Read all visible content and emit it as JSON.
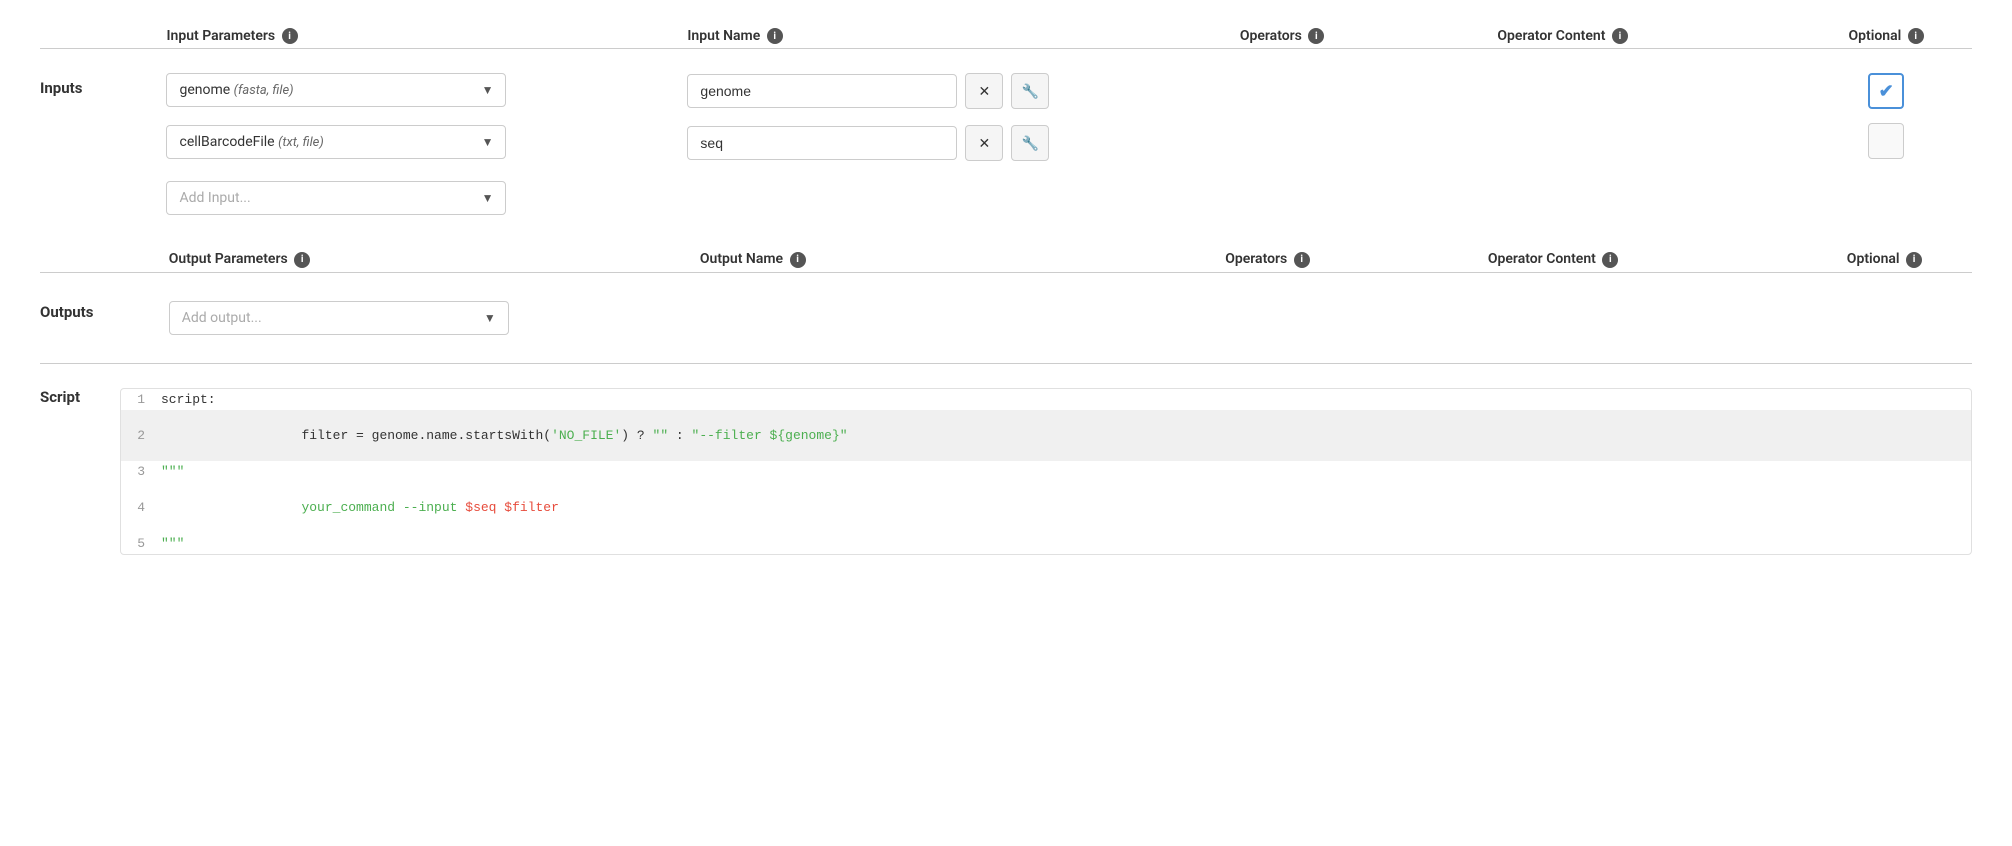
{
  "inputs_section": {
    "label": "Inputs",
    "columns": {
      "input_parameters": "Input Parameters",
      "input_name": "Input Name",
      "operators": "Operators",
      "operator_content": "Operator Content",
      "optional": "Optional"
    },
    "rows": [
      {
        "parameter_label": "genome",
        "parameter_detail": "(fasta, file)",
        "name_value": "genome",
        "optional_checked": true
      },
      {
        "parameter_label": "cellBarcodeFile",
        "parameter_detail": "(txt, file)",
        "name_value": "seq",
        "optional_checked": false
      }
    ],
    "add_input_placeholder": "Add Input..."
  },
  "outputs_section": {
    "label": "Outputs",
    "columns": {
      "output_parameters": "Output Parameters",
      "output_name": "Output Name",
      "operators": "Operators",
      "operator_content": "Operator Content",
      "optional": "Optional"
    },
    "add_output_placeholder": "Add output..."
  },
  "script_section": {
    "label": "Script",
    "lines": [
      {
        "num": "1",
        "content": "script:",
        "highlighted": false,
        "parts": [
          {
            "text": "script:",
            "class": "c-default"
          }
        ]
      },
      {
        "num": "2",
        "content": "filter = genome.name.startsWith('NO_FILE') ? \"\" : \"--filter ${genome}\"",
        "highlighted": true,
        "parts": [
          {
            "text": "filter = genome.name.startsWith(",
            "class": "c-default"
          },
          {
            "text": "'NO_FILE'",
            "class": "c-string"
          },
          {
            "text": ") ? ",
            "class": "c-default"
          },
          {
            "text": "\"\"",
            "class": "c-string"
          },
          {
            "text": " : ",
            "class": "c-default"
          },
          {
            "text": "\"--filter ${genome}\"",
            "class": "c-string"
          }
        ]
      },
      {
        "num": "3",
        "content": "\"\"\"",
        "highlighted": false,
        "parts": [
          {
            "text": "\"\"\"",
            "class": "c-green"
          }
        ]
      },
      {
        "num": "4",
        "content": "your_command --input $seq $filter",
        "highlighted": false,
        "parts": [
          {
            "text": "your_command --input ",
            "class": "c-green"
          },
          {
            "text": "$seq",
            "class": "c-var"
          },
          {
            "text": " ",
            "class": "c-green"
          },
          {
            "text": "$filter",
            "class": "c-var"
          }
        ]
      },
      {
        "num": "5",
        "content": "\"\"\"",
        "highlighted": false,
        "parts": [
          {
            "text": "\"\"\"",
            "class": "c-green"
          }
        ]
      }
    ]
  },
  "icons": {
    "info": "i",
    "dropdown_arrow": "▼",
    "close": "✕",
    "wrench": "🔧",
    "check": "✔"
  }
}
